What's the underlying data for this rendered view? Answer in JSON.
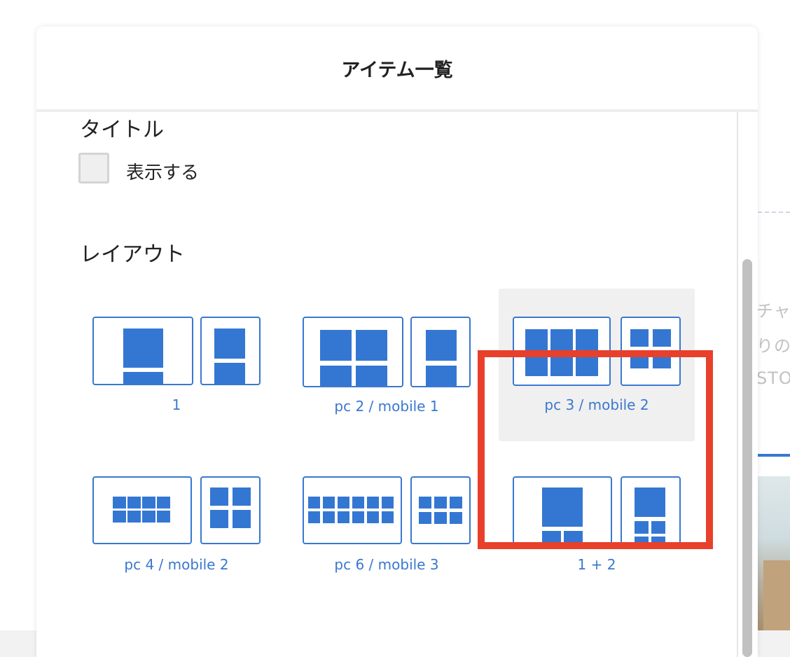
{
  "modal": {
    "title": "アイテム一覧"
  },
  "title_section": {
    "label": "タイトル",
    "checkbox_label": "表示する",
    "checked": false
  },
  "layout_section": {
    "label": "レイアウト",
    "options": [
      {
        "label": "1",
        "selected": false
      },
      {
        "label": "pc 2 / mobile 1",
        "selected": false
      },
      {
        "label": "pc 3 / mobile 2",
        "selected": true
      },
      {
        "label": "pc 4 / mobile 2",
        "selected": false
      },
      {
        "label": "pc 6 / mobile 3",
        "selected": false
      },
      {
        "label": "1 + 2",
        "selected": false
      }
    ]
  },
  "background": {
    "text_lines": [
      "チャ",
      "りのお",
      "STO"
    ]
  },
  "colors": {
    "accent": "#3477d3",
    "highlight": "#e8402a"
  }
}
